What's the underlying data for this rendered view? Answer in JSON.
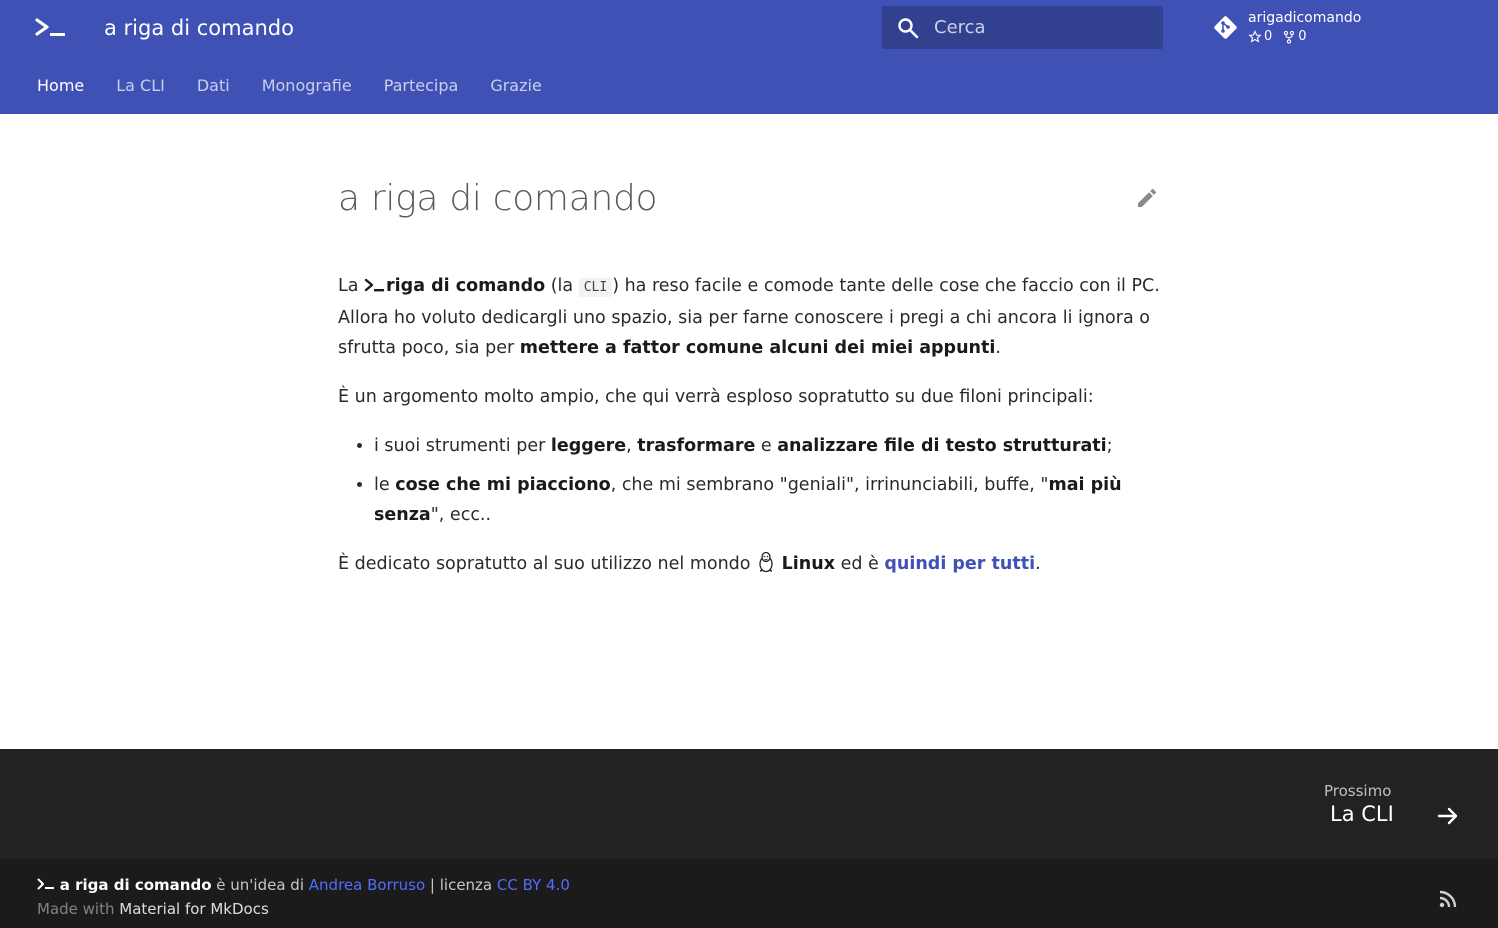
{
  "header": {
    "site_title": "a riga di comando",
    "logo_icon": "terminal-prompt-icon",
    "search_placeholder": "Cerca",
    "repo_name": "arigadicomando",
    "stars": "0",
    "forks": "0"
  },
  "tabs": [
    {
      "label": "Home",
      "active": true
    },
    {
      "label": "La CLI",
      "active": false
    },
    {
      "label": "Dati",
      "active": false
    },
    {
      "label": "Monografie",
      "active": false
    },
    {
      "label": "Partecipa",
      "active": false
    },
    {
      "label": "Grazie",
      "active": false
    }
  ],
  "content": {
    "title": "a riga di comando",
    "p1": {
      "t1": "La ",
      "b1": "riga di comando",
      "t2": " (la ",
      "code": "CLI",
      "t3": ") ha reso facile e comode tante delle cose che faccio con il PC. Allora ho voluto dedicargli uno spazio, sia per farne conoscere i pregi a chi ancora li ignora o sfrutta poco, sia per ",
      "b2": "mettere a fattor comune alcuni dei miei appunti",
      "t4": "."
    },
    "p2": "È un argomento molto ampio, che qui verrà esploso sopratutto su due filoni principali:",
    "li1": {
      "t1": "i suoi strumenti per ",
      "b1": "leggere",
      "t2": ", ",
      "b2": "trasformare",
      "t3": " e ",
      "b3": "analizzare file di testo strutturati",
      "t4": ";"
    },
    "li2": {
      "t1": "le ",
      "b1": "cose che mi piacciono",
      "t2": ", che mi sembrano \"geniali\", irrinunciabili, buffe, \"",
      "b2": "mai più senza",
      "t3": "\", ecc.."
    },
    "p3": {
      "t1": "È dedicato sopratutto al suo utilizzo nel mondo ",
      "b1": "Linux",
      "t2": " ed è ",
      "link": "quindi per tutti",
      "t3": "."
    }
  },
  "footer": {
    "next_label": "Prossimo",
    "next_title": "La CLI",
    "meta_brand": "a riga di comando",
    "meta_t1": " è un'idea di ",
    "meta_author": "Andrea Borruso",
    "meta_t2": " | licenza ",
    "meta_license": "CC BY 4.0",
    "made_with": "Made with ",
    "made_with_link": "Material for MkDocs"
  },
  "colors": {
    "primary": "#3f51b5",
    "footer": "#222222",
    "link": "#536dfe"
  }
}
